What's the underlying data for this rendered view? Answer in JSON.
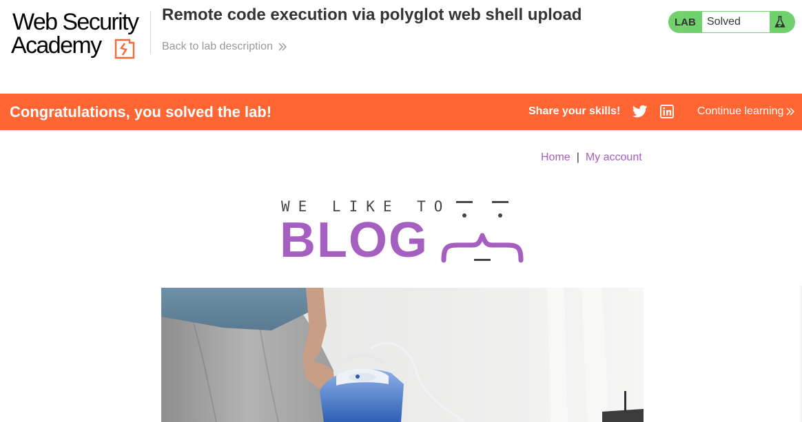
{
  "academy": {
    "logo_line1": "Web Security",
    "logo_line2": "Academy",
    "lab_title": "Remote code execution via polyglot web shell upload",
    "back_link": "Back to lab description",
    "lab_tag": "LAB",
    "lab_status": "Solved",
    "accent": "#ff6633",
    "status_color": "#70d16d"
  },
  "banner": {
    "message": "Congratulations, you solved the lab!",
    "share_label": "Share your skills!",
    "share_icons": [
      "twitter-icon",
      "linkedin-icon"
    ],
    "continue_label": "Continue learning",
    "color": "#ff6633"
  },
  "nav": {
    "home": "Home",
    "separator": "|",
    "my_account": "My account",
    "link_color": "#a45fc0"
  },
  "blog": {
    "tagline": "WE LIKE TO",
    "word": "BLOG",
    "brand_color": "#a45fc0"
  },
  "hero": {
    "icon": "blog-post-photo"
  }
}
